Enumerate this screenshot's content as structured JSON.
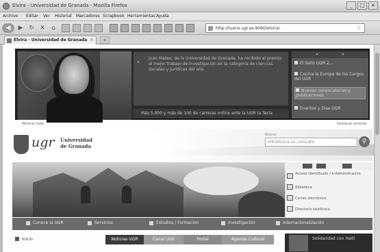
{
  "window": {
    "title": "Elvira - Universidad de Granada - Mozilla Firefox",
    "min_label": "_",
    "max_label": "□",
    "close_label": "×"
  },
  "menu": [
    "Archivo",
    "Editar",
    "Ver",
    "Historial",
    "Marcadores",
    "Scrapbook",
    "Herramientas",
    "Ayuda"
  ],
  "toolbar": {
    "url": "http://tueris.ugr.es:9090/elvira/",
    "star": "☆",
    "back": "◀",
    "forward": "▶",
    "reload": "↻",
    "stop": "✕",
    "home": "⌂"
  },
  "tab": {
    "label": "Elvira - Universidad de Granada",
    "close": "×",
    "new": "+"
  },
  "hero": {
    "news_text": "Juan Mateo, de la Universidad de Granada, ha recibido el premio al mejor trabajo de investigación en la categoría de ciencias sociales y jurídicas del año.",
    "news_footer": "Más 5.000 y más de 100 de carreras online ante la UGR la Tecla",
    "panel_title": "",
    "panel_items": [
      "El Sello UGR 2...",
      "Cocina la Europa de los Cargos del UGR",
      "Nuevas convocatorias y publicaciones",
      "Eventos y Dise UGR"
    ]
  },
  "under_hero": {
    "left": "Mostrar todo",
    "right": "Destacar anterior"
  },
  "header": {
    "ugr": "ugr",
    "univ_line1": "Universidad",
    "univ_line2": "de Granada",
    "search_label": "Buscar",
    "search_placeholder": "Introduzca su consulta",
    "search_icon": "⚲"
  },
  "side": {
    "items": [
      "Acceso Identificado / e-Administración",
      "Biblioteca",
      "Correo electrónico",
      "Directorio telefónico"
    ]
  },
  "nav": [
    "Conoce la UGR",
    "Servicios",
    "Estudios / Formación",
    "Investigación",
    "Internacionalización"
  ],
  "left": {
    "item": "Inicio"
  },
  "tabs": [
    "Noticias UGR",
    "Canal UGR",
    "Portal",
    "Agenda Cultural"
  ],
  "thumb": {
    "label": "Solidaridad con Haití"
  }
}
